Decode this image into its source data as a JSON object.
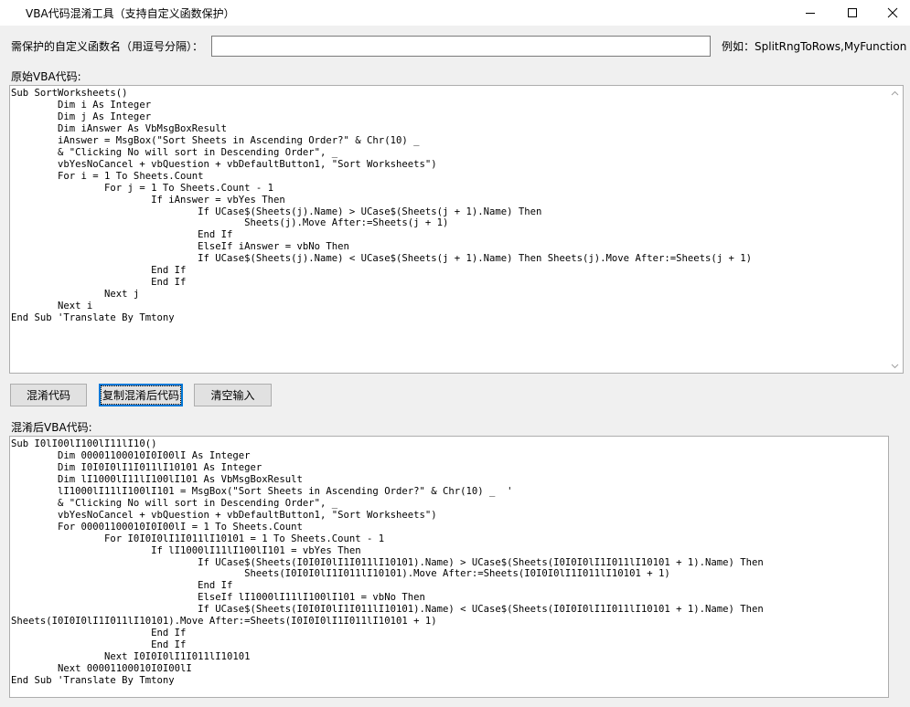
{
  "window": {
    "title": "VBA代码混淆工具（支持自定义函数保护）"
  },
  "protect": {
    "label": "需保护的自定义函数名（用逗号分隔）：",
    "value": "",
    "example": "例如：SplitRngToRows,MyFunction"
  },
  "original": {
    "label": "原始VBA代码:",
    "code": "Sub SortWorksheets()\n        Dim i As Integer\n        Dim j As Integer\n        Dim iAnswer As VbMsgBoxResult\n        iAnswer = MsgBox(\"Sort Sheets in Ascending Order?\" & Chr(10) _\n        & \"Clicking No will sort in Descending Order\", _\n        vbYesNoCancel + vbQuestion + vbDefaultButton1, \"Sort Worksheets\")\n        For i = 1 To Sheets.Count\n                For j = 1 To Sheets.Count - 1\n                        If iAnswer = vbYes Then\n                                If UCase$(Sheets(j).Name) > UCase$(Sheets(j + 1).Name) Then\n                                        Sheets(j).Move After:=Sheets(j + 1)\n                                End If\n                                ElseIf iAnswer = vbNo Then\n                                If UCase$(Sheets(j).Name) < UCase$(Sheets(j + 1).Name) Then Sheets(j).Move After:=Sheets(j + 1)\n                        End If\n                        End If\n                Next j\n        Next i\nEnd Sub 'Translate By Tmtony"
  },
  "buttons": {
    "obfuscate": "混淆代码",
    "copy": "复制混淆后代码",
    "clear": "清空输入"
  },
  "obfuscated": {
    "label": "混淆后VBA代码:",
    "code": "Sub I0lI00lI100lI11lI10()\n        Dim 00001100010I0I00lI As Integer\n        Dim I0I0I0lI1I011lI10101 As Integer\n        Dim lI1000lI11lI100lI101 As VbMsgBoxResult\n        lI1000lI11lI100lI101 = MsgBox(\"Sort Sheets in Ascending Order?\" & Chr(10) _  '\n        & \"Clicking No will sort in Descending Order\", _\n        vbYesNoCancel + vbQuestion + vbDefaultButton1, \"Sort Worksheets\")\n        For 00001100010I0I00lI = 1 To Sheets.Count\n                For I0I0I0lI1I011lI10101 = 1 To Sheets.Count - 1\n                        If lI1000lI11lI100lI101 = vbYes Then\n                                If UCase$(Sheets(I0I0I0lI1I011lI10101).Name) > UCase$(Sheets(I0I0I0lI1I011lI10101 + 1).Name) Then\n                                        Sheets(I0I0I0lI1I011lI10101).Move After:=Sheets(I0I0I0lI1I011lI10101 + 1)\n                                End If\n                                ElseIf lI1000lI11lI100lI101 = vbNo Then\n                                If UCase$(Sheets(I0I0I0lI1I011lI10101).Name) < UCase$(Sheets(I0I0I0lI1I011lI10101 + 1).Name) Then\nSheets(I0I0I0lI1I011lI10101).Move After:=Sheets(I0I0I0lI1I011lI10101 + 1)\n                        End If\n                        End If\n                Next I0I0I0lI1I011lI10101\n        Next 00001100010I0I00lI\nEnd Sub 'Translate By Tmtony"
  }
}
